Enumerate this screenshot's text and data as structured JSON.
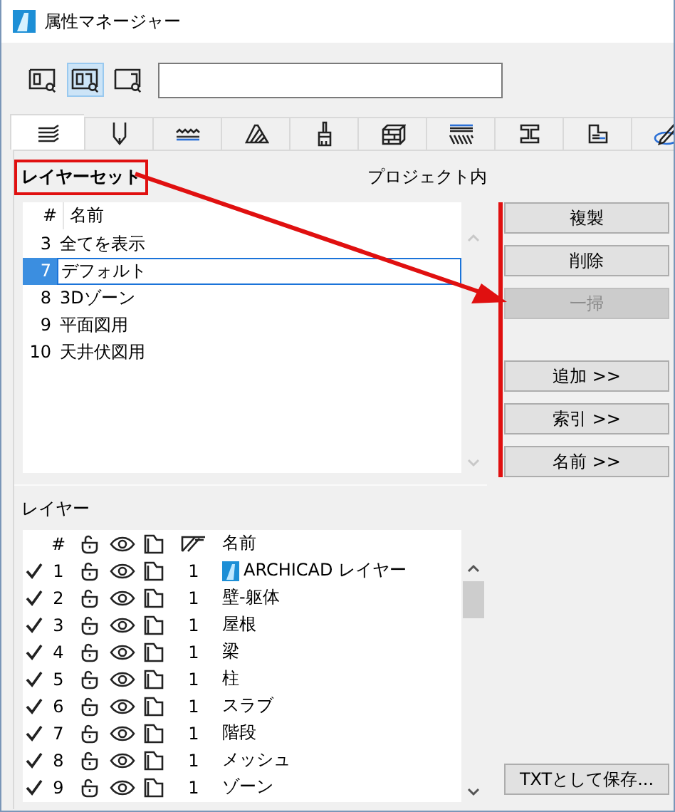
{
  "window": {
    "title": "属性マネージャー"
  },
  "view_buttons": [
    {
      "kind": "left",
      "selected": false
    },
    {
      "kind": "both",
      "selected": true
    },
    {
      "kind": "right",
      "selected": false
    }
  ],
  "tabs": [
    {
      "kind": "layers",
      "selected": true
    },
    {
      "kind": "pen",
      "selected": false
    },
    {
      "kind": "line",
      "selected": false
    },
    {
      "kind": "hatch",
      "selected": false
    },
    {
      "kind": "brush",
      "selected": false
    },
    {
      "kind": "brick",
      "selected": false
    },
    {
      "kind": "stripes",
      "selected": false
    },
    {
      "kind": "beam",
      "selected": false
    },
    {
      "kind": "zone",
      "selected": false
    },
    {
      "kind": "markup",
      "selected": false
    }
  ],
  "layer_sets": {
    "title": "レイヤーセット",
    "scope": "プロジェクト内",
    "columns": [
      "#",
      "名前"
    ],
    "rows": [
      {
        "number": "3",
        "name": "全てを表示",
        "selected": false
      },
      {
        "number": "7",
        "name": "デフォルト",
        "selected": true
      },
      {
        "number": "8",
        "name": "3Dゾーン",
        "selected": false
      },
      {
        "number": "9",
        "name": "平面図用",
        "selected": false
      },
      {
        "number": "10",
        "name": "天井伏図用",
        "selected": false
      }
    ]
  },
  "buttons": [
    {
      "label": "複製",
      "disabled": false
    },
    {
      "label": "削除",
      "disabled": false
    },
    {
      "label": "一掃",
      "disabled": true
    },
    {
      "label": "追加 >>",
      "disabled": false
    },
    {
      "label": "索引 >>",
      "disabled": false
    },
    {
      "label": "名前 >>",
      "disabled": false
    }
  ],
  "layers": {
    "title": "レイヤー",
    "columns": [
      "#",
      "名前"
    ],
    "rows": [
      {
        "checked": true,
        "number": "1",
        "pen": "1",
        "name": "ARCHICAD レイヤー",
        "kind": "app"
      },
      {
        "checked": true,
        "number": "2",
        "pen": "1",
        "name": "壁-躯体",
        "kind": "plain"
      },
      {
        "checked": true,
        "number": "3",
        "pen": "1",
        "name": "屋根",
        "kind": "plain"
      },
      {
        "checked": true,
        "number": "4",
        "pen": "1",
        "name": "梁",
        "kind": "plain"
      },
      {
        "checked": true,
        "number": "5",
        "pen": "1",
        "name": "柱",
        "kind": "plain"
      },
      {
        "checked": true,
        "number": "6",
        "pen": "1",
        "name": "スラブ",
        "kind": "plain"
      },
      {
        "checked": true,
        "number": "7",
        "pen": "1",
        "name": "階段",
        "kind": "plain"
      },
      {
        "checked": true,
        "number": "8",
        "pen": "1",
        "name": "メッシュ",
        "kind": "plain"
      },
      {
        "checked": true,
        "number": "9",
        "pen": "1",
        "name": "ゾーン",
        "kind": "plain"
      }
    ]
  },
  "save_button": {
    "label": "TXTとして保存..."
  }
}
